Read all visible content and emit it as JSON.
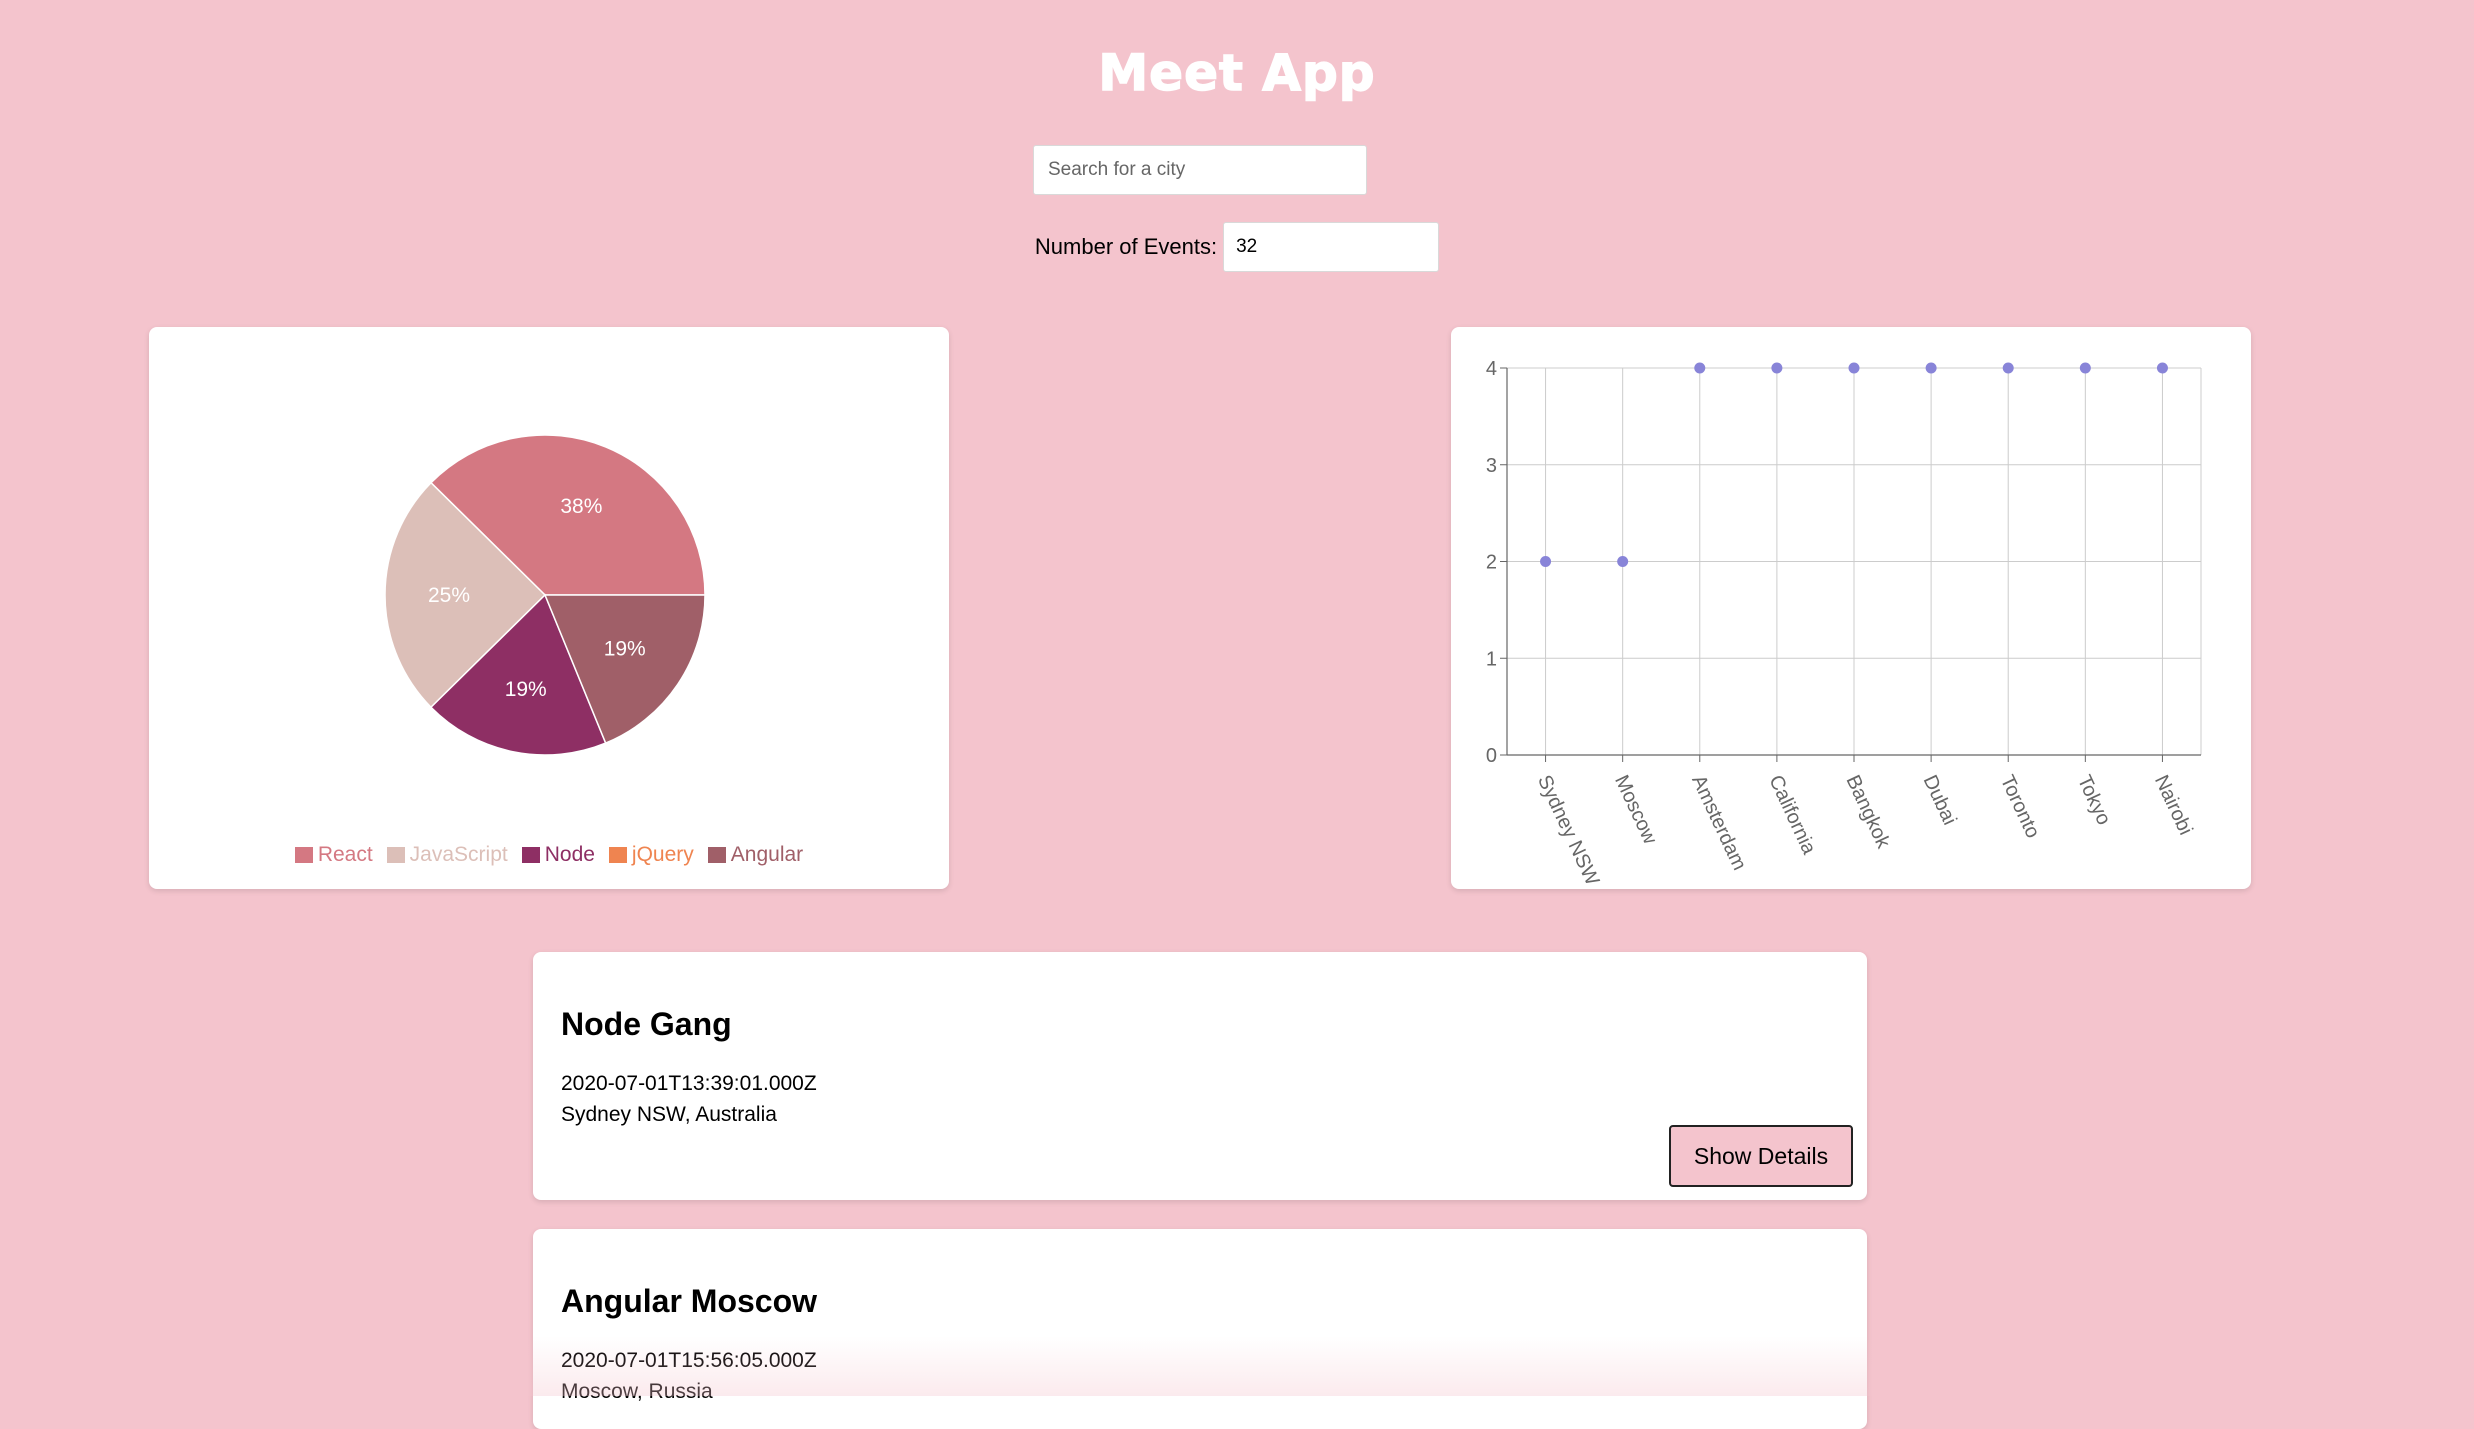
{
  "app": {
    "title": "Meet App"
  },
  "search": {
    "placeholder": "Search for a city",
    "value": ""
  },
  "events_filter": {
    "label": "Number of Events:",
    "value": "32"
  },
  "chart_data": [
    {
      "type": "pie",
      "categories": [
        "React",
        "JavaScript",
        "Node",
        "jQuery",
        "Angular"
      ],
      "values": [
        38,
        25,
        19,
        0,
        19
      ],
      "labels": [
        "38%",
        "25%",
        "19%",
        "",
        "19%"
      ],
      "colors": [
        "#d47882",
        "#dcbfb8",
        "#8e2f64",
        "#ef8450",
        "#a05f68"
      ],
      "legend": "bottom"
    },
    {
      "type": "scatter",
      "categories": [
        "Sydney NSW",
        "Moscow",
        "Amsterdam",
        "California",
        "Bangkok",
        "Dubai",
        "Toronto",
        "Tokyo",
        "Nairobi"
      ],
      "values": [
        2,
        2,
        4,
        4,
        4,
        4,
        4,
        4,
        4
      ],
      "yticks": [
        0,
        1,
        2,
        3,
        4
      ],
      "ylim": [
        0,
        4
      ],
      "grid": true,
      "point_color": "#8884d8"
    }
  ],
  "events": [
    {
      "name": "Node Gang",
      "date": "2020-07-01T13:39:01.000Z",
      "location": "Sydney NSW, Australia",
      "button": "Show Details"
    },
    {
      "name": "Angular Moscow",
      "date": "2020-07-01T15:56:05.000Z",
      "location": "Moscow, Russia"
    }
  ],
  "colors": {
    "background": "#f4c4cd",
    "card": "#ffffff"
  }
}
